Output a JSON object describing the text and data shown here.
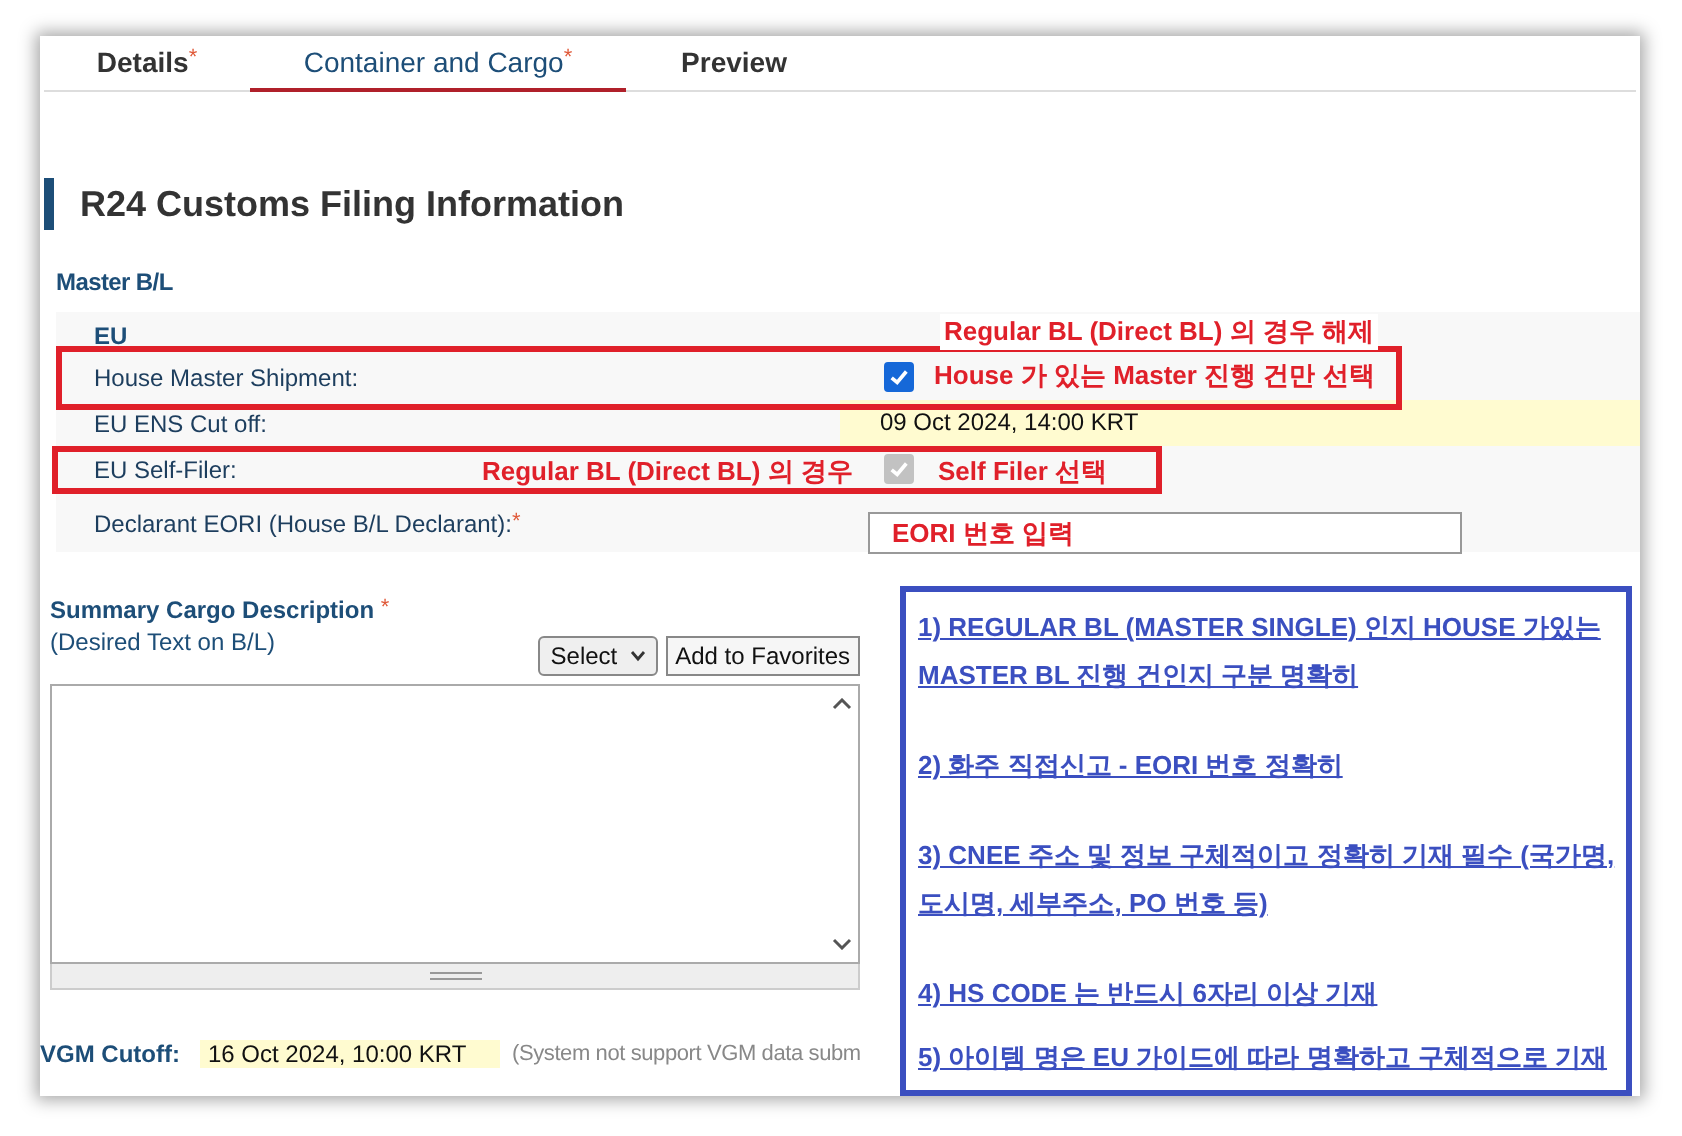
{
  "tabs": [
    {
      "label": "Details",
      "mark": "*",
      "selected": false
    },
    {
      "label": "Container and Cargo",
      "mark": "*",
      "selected": true
    },
    {
      "label": "Preview",
      "selected": false
    }
  ],
  "section_title": "R24 Customs Filing Information",
  "group_title": "Master B/L",
  "region": "EU",
  "fields": [
    {
      "kind": "checkbox",
      "label": "House Master Shipment:",
      "checked": true,
      "disabled": false
    },
    {
      "kind": "datetime",
      "label": "EU ENS Cut off:",
      "value": "09 Oct 2024, 14:00 KRT",
      "highlighted": true
    },
    {
      "kind": "checkbox",
      "label": "EU Self-Filer:",
      "checked": true,
      "disabled": true
    },
    {
      "kind": "input",
      "label": "Declarant EORI (House B/L Declarant):",
      "mark": "*"
    }
  ],
  "summary": {
    "title": "Summary Cargo Description",
    "mark": "*",
    "subtitle": "(Desired Text on B/L)",
    "select": "Select",
    "favorites_button": "Add to Favorites"
  },
  "vgm": {
    "label": "VGM Cutoff:",
    "value": "16 Oct 2024, 10:00 KRT",
    "note": "(System not support VGM data subm"
  },
  "annotations": {
    "red_notes": [
      "Regular BL (Direct BL) 의 경우 해제",
      "House 가 있는 Master 진행 건만 선택",
      "Regular BL (Direct BL) 의 경우",
      "Self Filer 선택",
      "EORI 번호 입력"
    ],
    "blue_notes": [
      "1)  REGULAR BL (MASTER SINGLE)  인지 HOUSE 가있는 MASTER BL 진행 건인지 구분 명확히",
      "2) 화주 직접신고  - EORI 번호 정확히",
      "3) CNEE 주소 및 정보 구체적이고 정확히 기재 필수 (국가명, 도시명, 세부주소, PO 번호 등)",
      "4) HS CODE 는 반드시 6자리 이상 기재",
      "5) 아이템 명은 EU 가이드에 따라 명확하고 구체적으로 기재"
    ]
  }
}
